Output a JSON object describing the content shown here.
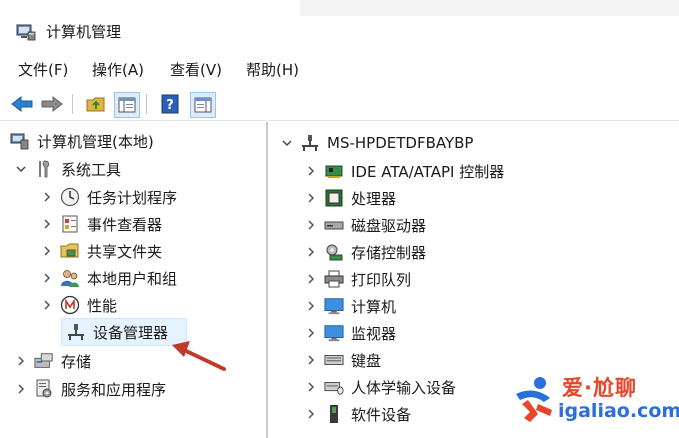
{
  "window": {
    "title": "计算机管理",
    "icon": "computer-management-icon"
  },
  "menu": [
    {
      "label": "文件(F)"
    },
    {
      "label": "操作(A)"
    },
    {
      "label": "查看(V)"
    },
    {
      "label": "帮助(H)"
    }
  ],
  "toolbar": {
    "buttons": [
      "back-arrow-icon",
      "forward-arrow-icon",
      "up-folder-icon",
      "show-hide-tree-icon",
      "help-icon",
      "action-pane-icon"
    ]
  },
  "left_tree": {
    "root": {
      "label": "计算机管理(本地)",
      "icon": "computer-management-icon"
    },
    "system_tools": {
      "label": "系统工具",
      "icon": "tools-icon"
    },
    "items": [
      {
        "label": "任务计划程序",
        "icon": "clock-icon"
      },
      {
        "label": "事件查看器",
        "icon": "event-viewer-icon"
      },
      {
        "label": "共享文件夹",
        "icon": "shared-folder-icon"
      },
      {
        "label": "本地用户和组",
        "icon": "users-icon"
      },
      {
        "label": "性能",
        "icon": "performance-icon"
      },
      {
        "label": "设备管理器",
        "icon": "device-manager-icon",
        "selected": true
      }
    ],
    "storage": {
      "label": "存储",
      "icon": "storage-icon"
    },
    "services": {
      "label": "服务和应用程序",
      "icon": "services-icon"
    }
  },
  "right_tree": {
    "root": {
      "label": "MS-HPDETDFBAYBP",
      "icon": "computer-icon"
    },
    "items": [
      {
        "label": "IDE ATA/ATAPI 控制器",
        "icon": "ide-controller-icon"
      },
      {
        "label": "处理器",
        "icon": "cpu-icon"
      },
      {
        "label": "磁盘驱动器",
        "icon": "disk-drive-icon"
      },
      {
        "label": "存储控制器",
        "icon": "storage-controller-icon"
      },
      {
        "label": "打印队列",
        "icon": "printer-icon"
      },
      {
        "label": "计算机",
        "icon": "monitor-icon"
      },
      {
        "label": "监视器",
        "icon": "monitor-icon"
      },
      {
        "label": "键盘",
        "icon": "keyboard-icon"
      },
      {
        "label": "人体学输入设备",
        "icon": "hid-icon"
      },
      {
        "label": "软件设备",
        "icon": "software-device-icon"
      }
    ]
  },
  "watermark": {
    "cn": "爱·尬聊",
    "en": "igaliao.com"
  },
  "colors": {
    "accent_arrow": "#c0392b",
    "selection": "#e5f3ff",
    "watermark_red": "#e8452b",
    "watermark_blue": "#2a6fdc"
  }
}
